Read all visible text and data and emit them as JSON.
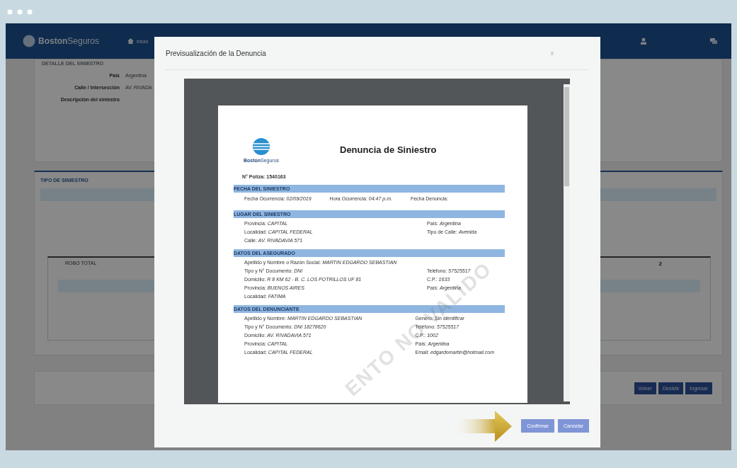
{
  "app": {
    "brand_bold": "Boston",
    "brand_light": "Seguros",
    "nav": [
      "Inicio"
    ]
  },
  "background": {
    "detail": {
      "title": "DETALLE DEL SINIESTRO",
      "fields": [
        {
          "label": "País",
          "value": "Argentina"
        },
        {
          "label": "Calle / Intersección",
          "value": "AV. RIVADA"
        },
        {
          "label": "Descripción del siniestro"
        }
      ]
    },
    "type_panel": {
      "title": "TIPO DE SINIESTRO",
      "card_title": "ROBO TOTAL",
      "badge": "2"
    },
    "buttons": [
      "Volver",
      "Desistir",
      "Ingresar"
    ]
  },
  "modal": {
    "title": "Previsualización de la Denuncia",
    "close": "x",
    "document": {
      "logo_bold": "Boston",
      "logo_light": "Seguros",
      "title": "Denuncia de Siniestro",
      "policy": "N° Poliza: 1540163",
      "watermark": "ENTO NO VALIDO",
      "sections": [
        {
          "kind": "inline",
          "title": "FECHA DEL SINIESTRO",
          "fields": [
            {
              "label": "Fecha Ocurrencia:",
              "value": "02/09/2019"
            },
            {
              "label": "Hora Ocurrencia:",
              "value": "04:47 p.m."
            },
            {
              "label": "Fecha Denuncia:"
            }
          ]
        },
        {
          "kind": "columns",
          "title": "LUGAR DEL SINIESTRO",
          "left": [
            {
              "label": "Provincia:",
              "value": "CAPITAL"
            },
            {
              "label": "Localidad:",
              "value": "CAPITAL FEDERAL"
            },
            {
              "label": "Calle:",
              "value": "AV. RIVADAVIA 571"
            }
          ],
          "right": [
            {
              "label": "País:",
              "value": "Argentina"
            },
            {
              "label": "Tipo de Calle:",
              "value": "Avenida"
            }
          ]
        },
        {
          "kind": "columns",
          "title": "DATOS DEL ASEGURADO",
          "lead": {
            "label": "Apellido y Nombre o Razón Social:",
            "value": "MARTIN EDGARDO SEBASTIAN"
          },
          "left": [
            {
              "label": "Tipo y N° Documento:",
              "value": "DNI"
            },
            {
              "label": "Domicilio:",
              "value": "R 8 KM 62 - B. C. LOS POTRILLOS UF 81"
            },
            {
              "label": "Provincia:",
              "value": "BUENOS AIRES"
            },
            {
              "label": "Localidad:",
              "value": "FATIMA"
            }
          ],
          "right": [
            {
              "label": "Teléfono:",
              "value": "57525517"
            },
            {
              "label": "C.P.:",
              "value": "1633"
            },
            {
              "label": "País:",
              "value": "Argentina"
            }
          ]
        },
        {
          "kind": "columns",
          "title": "DATOS DEL DENUNCIANTE",
          "left": [
            {
              "label": "Apellido y Nombre:",
              "value": "MARTIN EDGARDO SEBASTIAN"
            },
            {
              "label": "Tipo y N° Documento:",
              "value": "DNI 18278620"
            },
            {
              "label": "Domicilio:",
              "value": "AV. RIVADAVIA 571"
            },
            {
              "label": "Provincia:",
              "value": "CAPITAL"
            },
            {
              "label": "Localidad:",
              "value": "CAPITAL FEDERAL"
            }
          ],
          "right": [
            {
              "label": "Genero:",
              "value": "Sin identificar"
            },
            {
              "label": "Teléfono:",
              "value": "57525517"
            },
            {
              "label": "C.P.:",
              "value": "1002"
            },
            {
              "label": "País:",
              "value": "Argentina"
            },
            {
              "label": "Email:",
              "value": "edgardomartin@hotmail.com"
            }
          ]
        }
      ]
    },
    "buttons": [
      "Confirmar",
      "Cancelar"
    ]
  }
}
